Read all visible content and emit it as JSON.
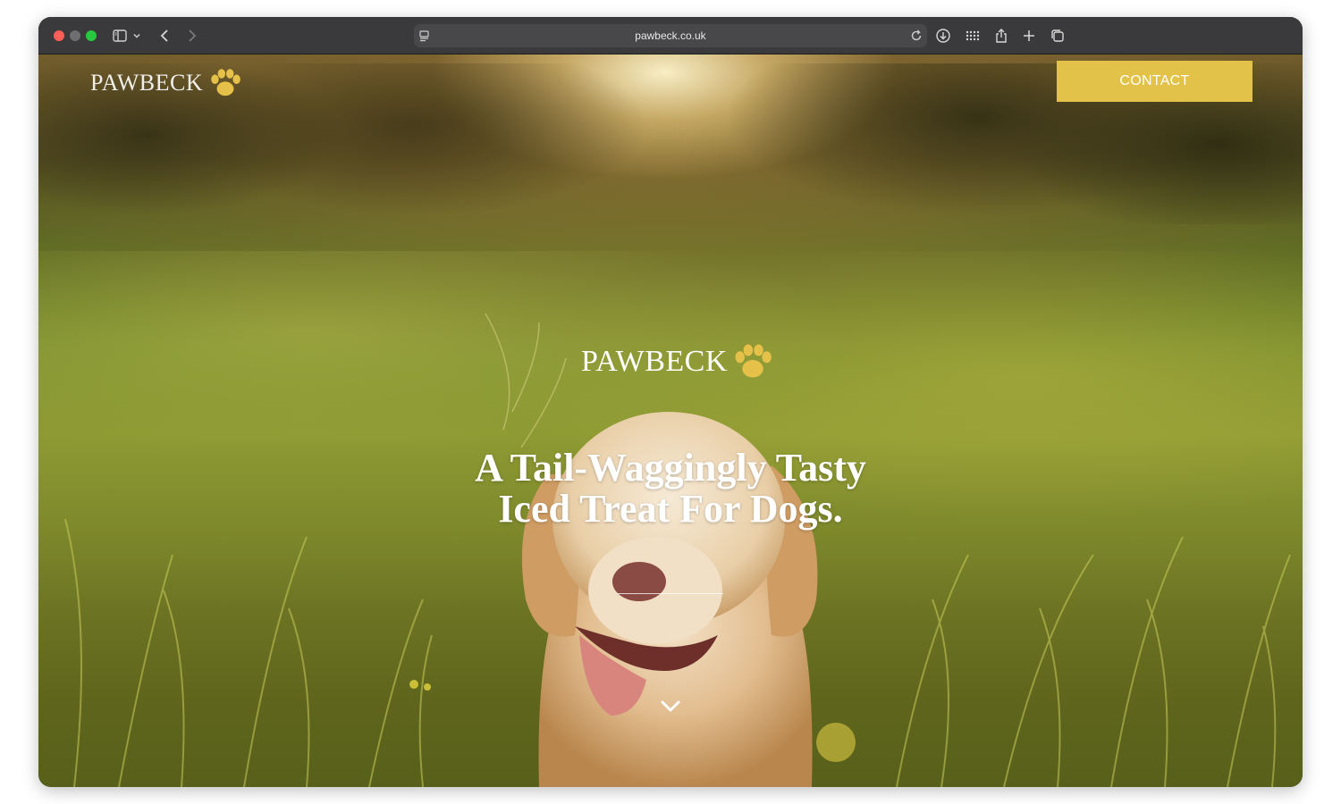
{
  "browser": {
    "url": "pawbeck.co.uk"
  },
  "header": {
    "logo_text": "PAWBECK",
    "contact_label": "CONTACT"
  },
  "hero": {
    "logo_text": "PAWBECK",
    "title_line1": "A Tail-Waggingly Tasty",
    "title_line2": "Iced Treat For Dogs."
  },
  "icons": {
    "sidebar": "sidebar-icon",
    "chevron": "chevron-down-icon",
    "back": "back-icon",
    "forward": "forward-icon",
    "reader": "reader-icon",
    "reload": "reload-icon",
    "download": "download-icon",
    "grid": "grid-icon",
    "share": "share-icon",
    "new_tab": "plus-icon",
    "tabs": "tabs-icon",
    "paw": "paw-icon",
    "scroll": "scroll-down-icon"
  },
  "colors": {
    "accent": "#e3c24a",
    "paw": "#e6c14a"
  }
}
